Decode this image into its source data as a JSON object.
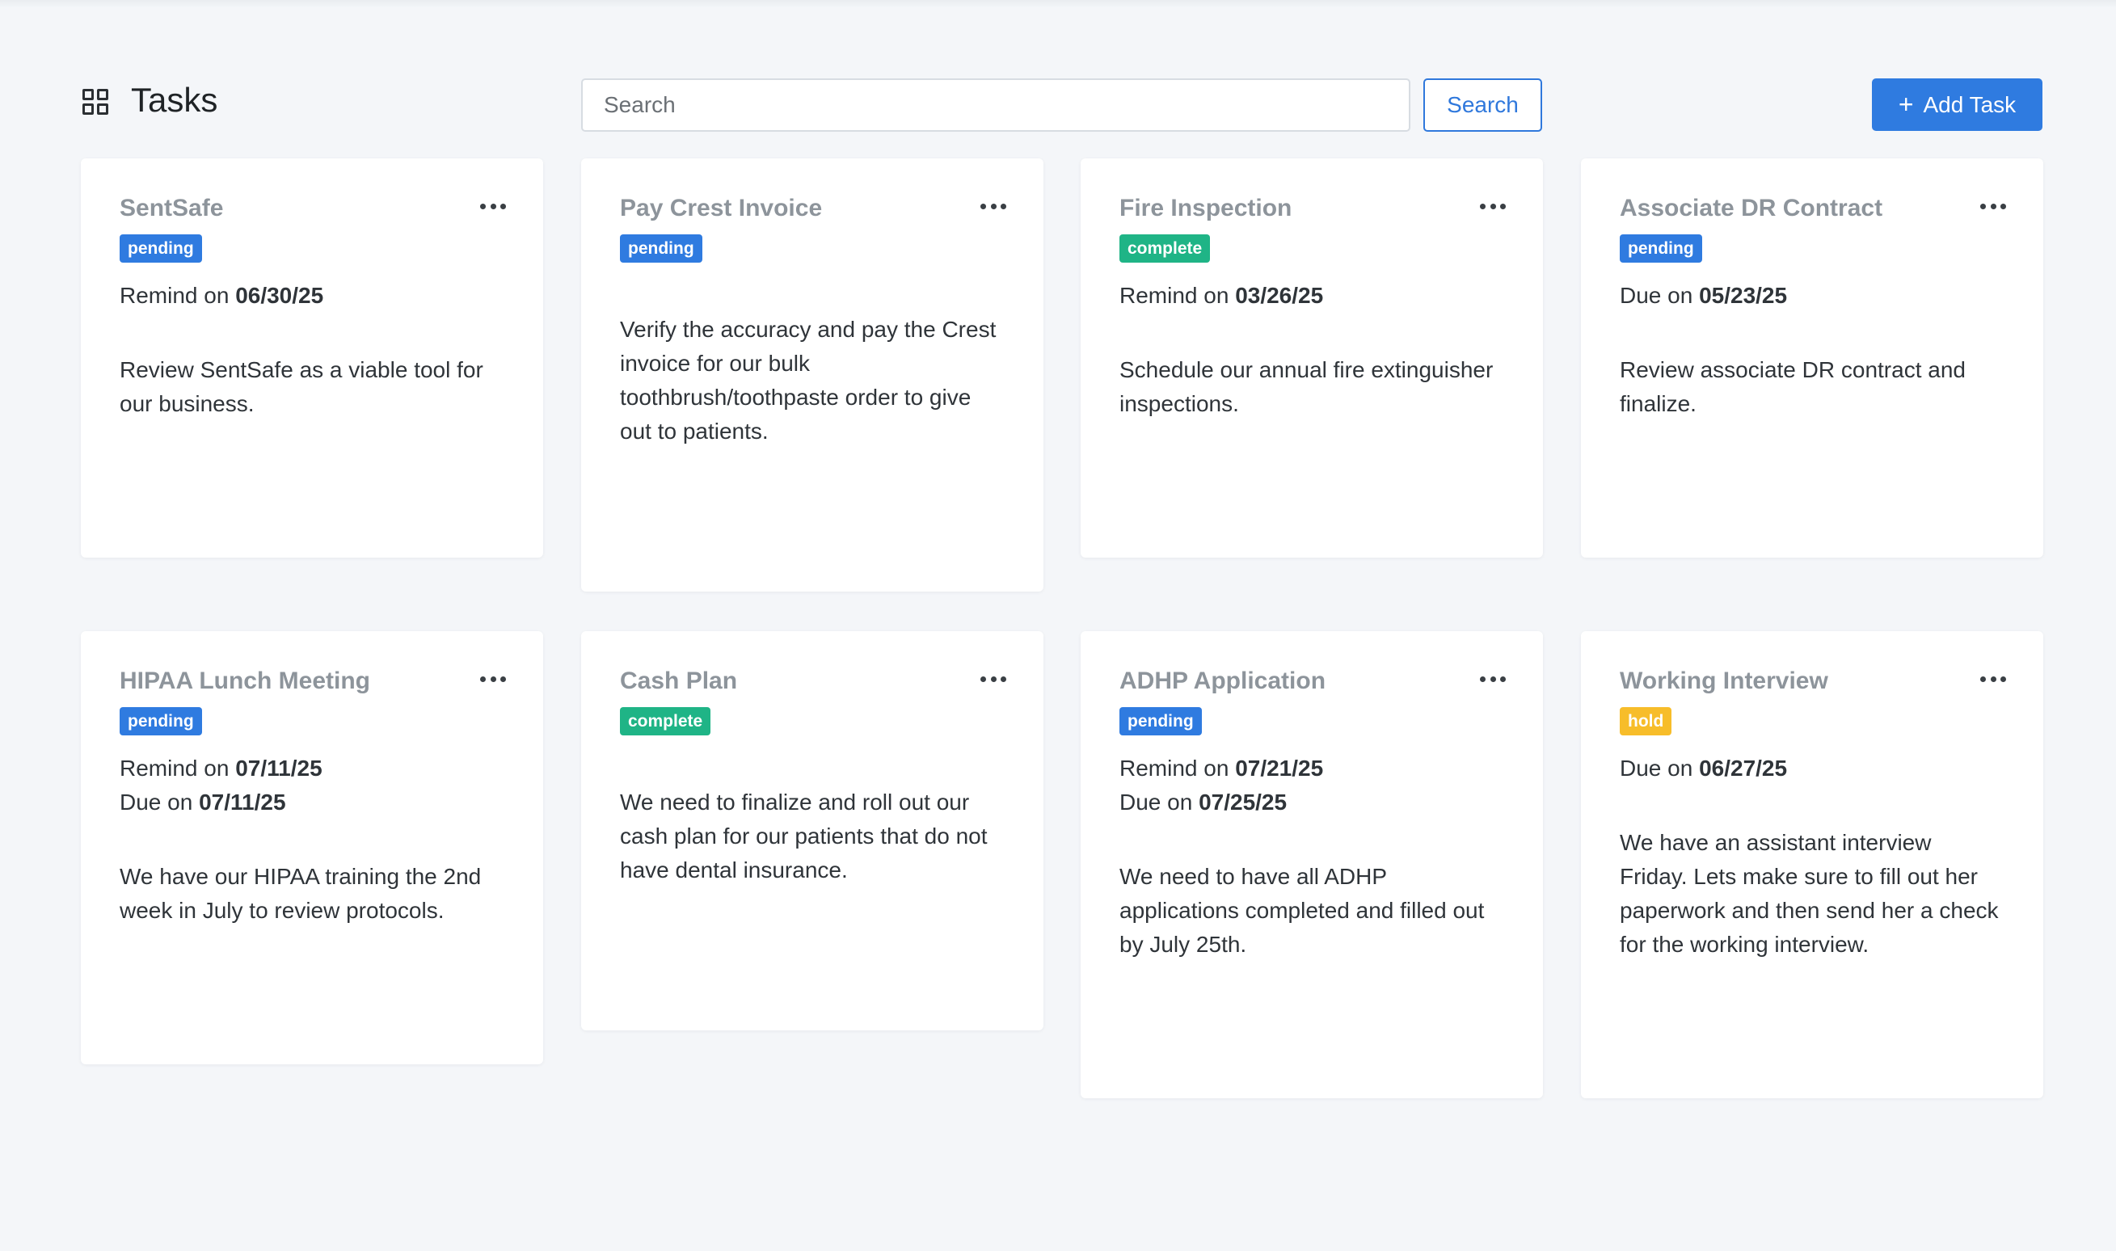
{
  "header": {
    "title": "Tasks",
    "icon": "grid-icon",
    "search_placeholder": "Search",
    "search_button": "Search",
    "add_button": "Add Task",
    "add_icon": "plus-icon"
  },
  "colors": {
    "pending": "#2f7be0",
    "complete": "#1fb486",
    "hold": "#f7bd2a",
    "title_gray": "#8d949b",
    "background": "#f4f6f9"
  },
  "cards": [
    {
      "title": "SentSafe",
      "status": "pending",
      "remind_label": "Remind on",
      "remind": "06/30/25",
      "due_label": "",
      "due": "",
      "description": "Review SentSafe as a viable tool for our business."
    },
    {
      "title": "Pay Crest Invoice",
      "status": "pending",
      "remind_label": "",
      "remind": "",
      "due_label": "",
      "due": "",
      "description": "Verify the accuracy and pay the Crest invoice for our bulk toothbrush/toothpaste order to give out to patients."
    },
    {
      "title": "Fire Inspection",
      "status": "complete",
      "remind_label": "Remind on",
      "remind": "03/26/25",
      "due_label": "",
      "due": "",
      "description": "Schedule our annual fire extinguisher inspections."
    },
    {
      "title": "Associate DR Contract",
      "status": "pending",
      "remind_label": "",
      "remind": "",
      "due_label": "Due on",
      "due": "05/23/25",
      "description": "Review associate DR contract and finalize."
    },
    {
      "title": "HIPAA Lunch Meeting",
      "status": "pending",
      "remind_label": "Remind on",
      "remind": "07/11/25",
      "due_label": "Due on",
      "due": "07/11/25",
      "description": "We have our HIPAA training the 2nd week in July to review protocols."
    },
    {
      "title": "Cash Plan",
      "status": "complete",
      "remind_label": "",
      "remind": "",
      "due_label": "",
      "due": "",
      "description": "We need to finalize and roll out our cash plan for our patients that do not have dental insurance."
    },
    {
      "title": "ADHP Application",
      "status": "pending",
      "remind_label": "Remind on",
      "remind": "07/21/25",
      "due_label": "Due on",
      "due": "07/25/25",
      "description": "We need to have all ADHP applications completed and filled out by July 25th."
    },
    {
      "title": "Working Interview",
      "status": "hold",
      "remind_label": "",
      "remind": "",
      "due_label": "Due on",
      "due": "06/27/25",
      "description": "We have an assistant interview Friday. Lets make sure to fill out her paperwork and then send her a check for the working interview."
    }
  ]
}
